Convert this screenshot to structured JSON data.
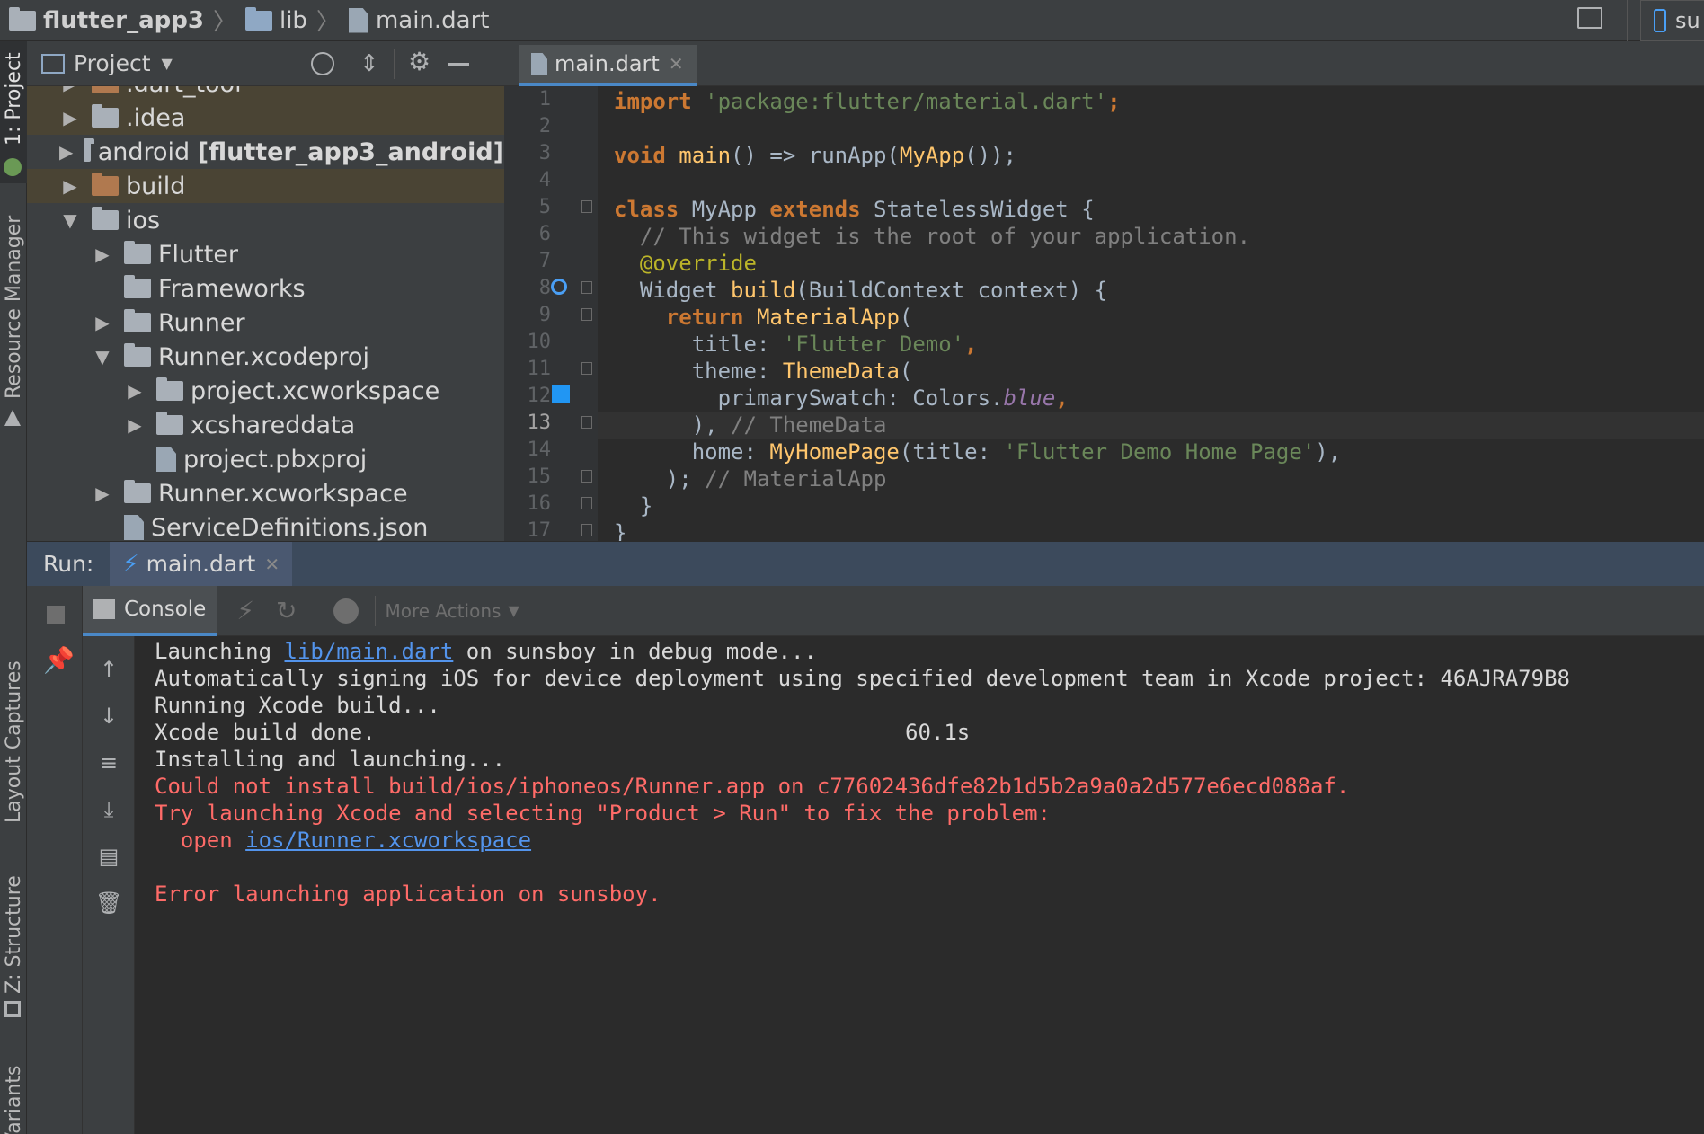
{
  "breadcrumb": [
    "flutter_app3",
    "lib",
    "main.dart"
  ],
  "device_label": "su",
  "left_strip": {
    "project_tab": "1: Project",
    "resource_manager": "Resource Manager",
    "layout_captures": "Layout Captures",
    "structure": "Z: Structure",
    "variants": "d Variants"
  },
  "project_panel": {
    "title": "Project",
    "tree": [
      {
        "label": ".dart_tool",
        "expanded": false,
        "depth": 0,
        "icon": "folder-brown"
      },
      {
        "label": ".idea",
        "expanded": false,
        "depth": 0,
        "icon": "folder-gear"
      },
      {
        "label": "android ",
        "bold_suffix": "[flutter_app3_android]",
        "expanded": false,
        "depth": 0,
        "icon": "folder-module"
      },
      {
        "label": "build",
        "expanded": false,
        "depth": 0,
        "icon": "folder-brown"
      },
      {
        "label": "ios",
        "expanded": true,
        "depth": 0,
        "icon": "folder"
      },
      {
        "label": "Flutter",
        "expanded": false,
        "depth": 1,
        "icon": "folder"
      },
      {
        "label": "Frameworks",
        "expanded": null,
        "depth": 1,
        "icon": "folder"
      },
      {
        "label": "Runner",
        "expanded": false,
        "depth": 1,
        "icon": "folder"
      },
      {
        "label": "Runner.xcodeproj",
        "expanded": true,
        "depth": 1,
        "icon": "folder"
      },
      {
        "label": "project.xcworkspace",
        "expanded": false,
        "depth": 2,
        "icon": "folder"
      },
      {
        "label": "xcshareddata",
        "expanded": false,
        "depth": 2,
        "icon": "folder"
      },
      {
        "label": "project.pbxproj",
        "expanded": null,
        "depth": 2,
        "icon": "file"
      },
      {
        "label": "Runner.xcworkspace",
        "expanded": false,
        "depth": 1,
        "icon": "folder"
      },
      {
        "label": "ServiceDefinitions.json",
        "expanded": null,
        "depth": 1,
        "icon": "file-json"
      }
    ]
  },
  "editor": {
    "tab_label": "main.dart",
    "line_numbers": [
      "1",
      "2",
      "3",
      "4",
      "5",
      "6",
      "7",
      "8",
      "9",
      "10",
      "11",
      "12",
      "13",
      "14",
      "15",
      "16",
      "17"
    ],
    "current_line": "13"
  },
  "run_panel": {
    "label": "Run:",
    "tab_label": "main.dart",
    "console_label": "Console",
    "more_actions": "More Actions",
    "lines": {
      "l1a": "Launching ",
      "l1link": "lib/main.dart",
      "l1b": " on sunsboy in debug mode...",
      "l2": "Automatically signing iOS for device deployment using specified development team in Xcode project: 46AJRA79B8",
      "l3": "Running Xcode build...",
      "l4": "Xcode build done.",
      "l4time": "60.1s",
      "l5": "Installing and launching...",
      "l6": "Could not install build/ios/iphoneos/Runner.app on c77602436dfe82b1d5b2a9a0a2d577e6ecd088af.",
      "l7": "Try launching Xcode and selecting \"Product > Run\" to fix the problem:",
      "l8a": "  open ",
      "l8link": "ios/Runner.xcworkspace",
      "l10": "Error launching application on sunsboy."
    }
  },
  "colors": {
    "keyword": "#cc7832",
    "string": "#6a8759",
    "error": "#ff6b68",
    "link": "#5394ec"
  }
}
